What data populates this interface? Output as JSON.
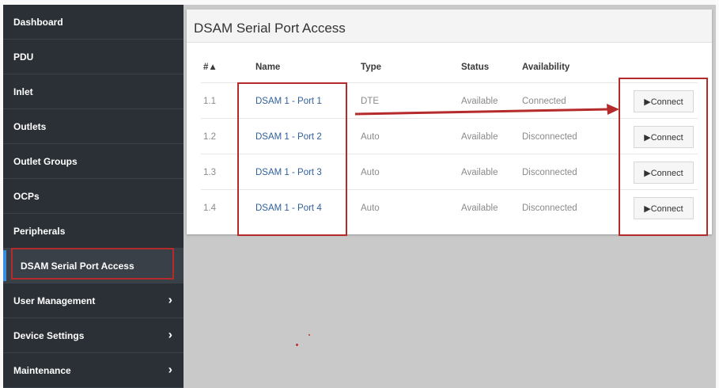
{
  "sidebar": {
    "items": [
      {
        "label": "Dashboard",
        "chevron": false
      },
      {
        "label": "PDU",
        "chevron": false
      },
      {
        "label": "Inlet",
        "chevron": false
      },
      {
        "label": "Outlets",
        "chevron": false
      },
      {
        "label": "Outlet Groups",
        "chevron": false
      },
      {
        "label": "OCPs",
        "chevron": false
      },
      {
        "label": "Peripherals",
        "chevron": false
      },
      {
        "label": "DSAM Serial Port Access",
        "chevron": false,
        "active": true
      },
      {
        "label": "User Management",
        "chevron": true
      },
      {
        "label": "Device Settings",
        "chevron": true
      },
      {
        "label": "Maintenance",
        "chevron": true
      }
    ],
    "chevron_glyph": "›"
  },
  "panel": {
    "title": "DSAM Serial Port Access",
    "columns": {
      "num": "#▲",
      "name": "Name",
      "type": "Type",
      "status": "Status",
      "availability": "Availability"
    },
    "rows": [
      {
        "num": "1.1",
        "name": "DSAM 1 - Port 1",
        "type": "DTE",
        "status": "Available",
        "availability": "Connected",
        "action": "▶Connect"
      },
      {
        "num": "1.2",
        "name": "DSAM 1 - Port 2",
        "type": "Auto",
        "status": "Available",
        "availability": "Disconnected",
        "action": "▶Connect"
      },
      {
        "num": "1.3",
        "name": "DSAM 1 - Port 3",
        "type": "Auto",
        "status": "Available",
        "availability": "Disconnected",
        "action": "▶Connect"
      },
      {
        "num": "1.4",
        "name": "DSAM 1 - Port 4",
        "type": "Auto",
        "status": "Available",
        "availability": "Disconnected",
        "action": "▶Connect"
      }
    ]
  },
  "colors": {
    "sidebar_bg": "#2b3036",
    "highlight_red": "#b52a2a",
    "link_blue": "#2f5f9a",
    "active_accent": "#3a8dde"
  }
}
